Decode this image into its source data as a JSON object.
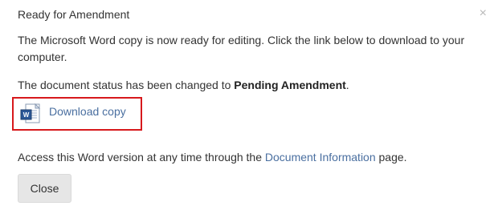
{
  "dialog": {
    "title": "Ready for Amendment",
    "close_icon_glyph": "×",
    "message_line1": "The Microsoft Word copy is now ready for editing. Click the link below to download to your computer.",
    "status_prefix": "The document status has been changed to ",
    "status_value": "Pending Amendment",
    "status_suffix": ".",
    "download_icon": "word-document-icon",
    "download_label": "Download copy",
    "access_prefix": "Access this Word version at any time through the ",
    "access_link": "Document Information",
    "access_suffix": " page.",
    "close_button_label": "Close"
  },
  "colors": {
    "link": "#4a6fa0",
    "highlight_border": "#d7191c",
    "button_bg": "#e6e6e6"
  }
}
